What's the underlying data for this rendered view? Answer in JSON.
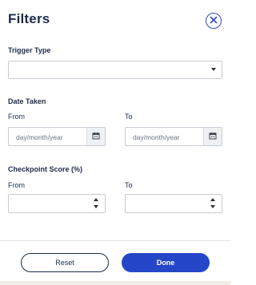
{
  "panel": {
    "title": "Filters",
    "close_icon": "close-circle-icon"
  },
  "trigger_type": {
    "label": "Trigger Type",
    "selected_value": ""
  },
  "date_taken": {
    "label": "Date Taken",
    "from_label": "From",
    "to_label": "To",
    "from_placeholder": "day/month/year",
    "to_placeholder": "day/month/year",
    "calendar_icon": "calendar-icon"
  },
  "checkpoint_score": {
    "label": "Checkpoint Score (%)",
    "from_label": "From",
    "to_label": "To",
    "from_value": "",
    "to_value": ""
  },
  "footer": {
    "reset_label": "Reset",
    "done_label": "Done"
  },
  "colors": {
    "primary": "#2446c7",
    "text": "#1c2b4a",
    "border": "#c7ccd4"
  }
}
